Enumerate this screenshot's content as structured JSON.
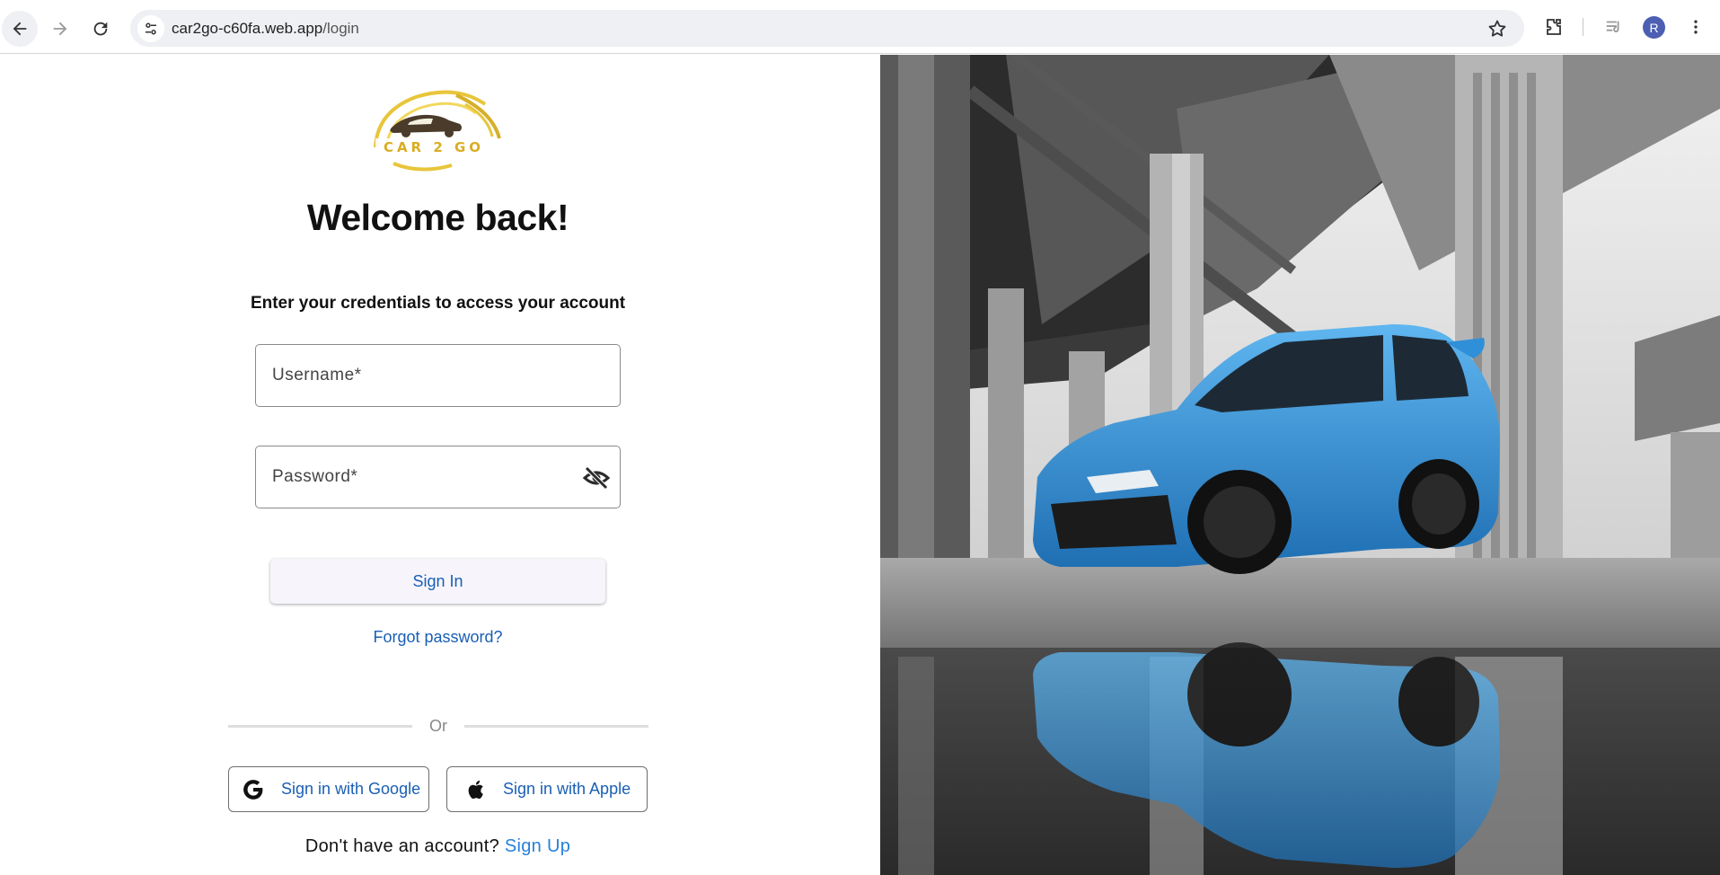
{
  "browser": {
    "url_host": "car2go-c60fa.web.app",
    "url_path": "/login",
    "profile_initial": "R"
  },
  "logo": {
    "text": "CAR 2 GO",
    "brand_color": "#e8c53a"
  },
  "login": {
    "heading": "Welcome back!",
    "subtitle": "Enter your credentials to access your account",
    "username_placeholder": "Username*",
    "password_placeholder": "Password*",
    "signin_label": "Sign In",
    "forgot_label": "Forgot password?",
    "divider_label": "Or",
    "google_label": "Sign in with Google",
    "apple_label": "Sign in with Apple",
    "signup_prompt": "Don't have an account?",
    "signup_link": "Sign Up"
  },
  "colors": {
    "link": "#1a5fb4",
    "signup_link": "#2680d9",
    "car_accent": "#2f8fd8"
  },
  "icons": {
    "back": "arrow-left-icon",
    "forward": "arrow-right-icon",
    "reload": "reload-icon",
    "site_info": "tune-icon",
    "bookmark": "star-icon",
    "extensions": "puzzle-icon",
    "media": "media-queue-icon",
    "menu": "kebab-menu-icon",
    "password_visibility": "eye-off-icon",
    "google": "google-icon",
    "apple": "apple-icon"
  }
}
